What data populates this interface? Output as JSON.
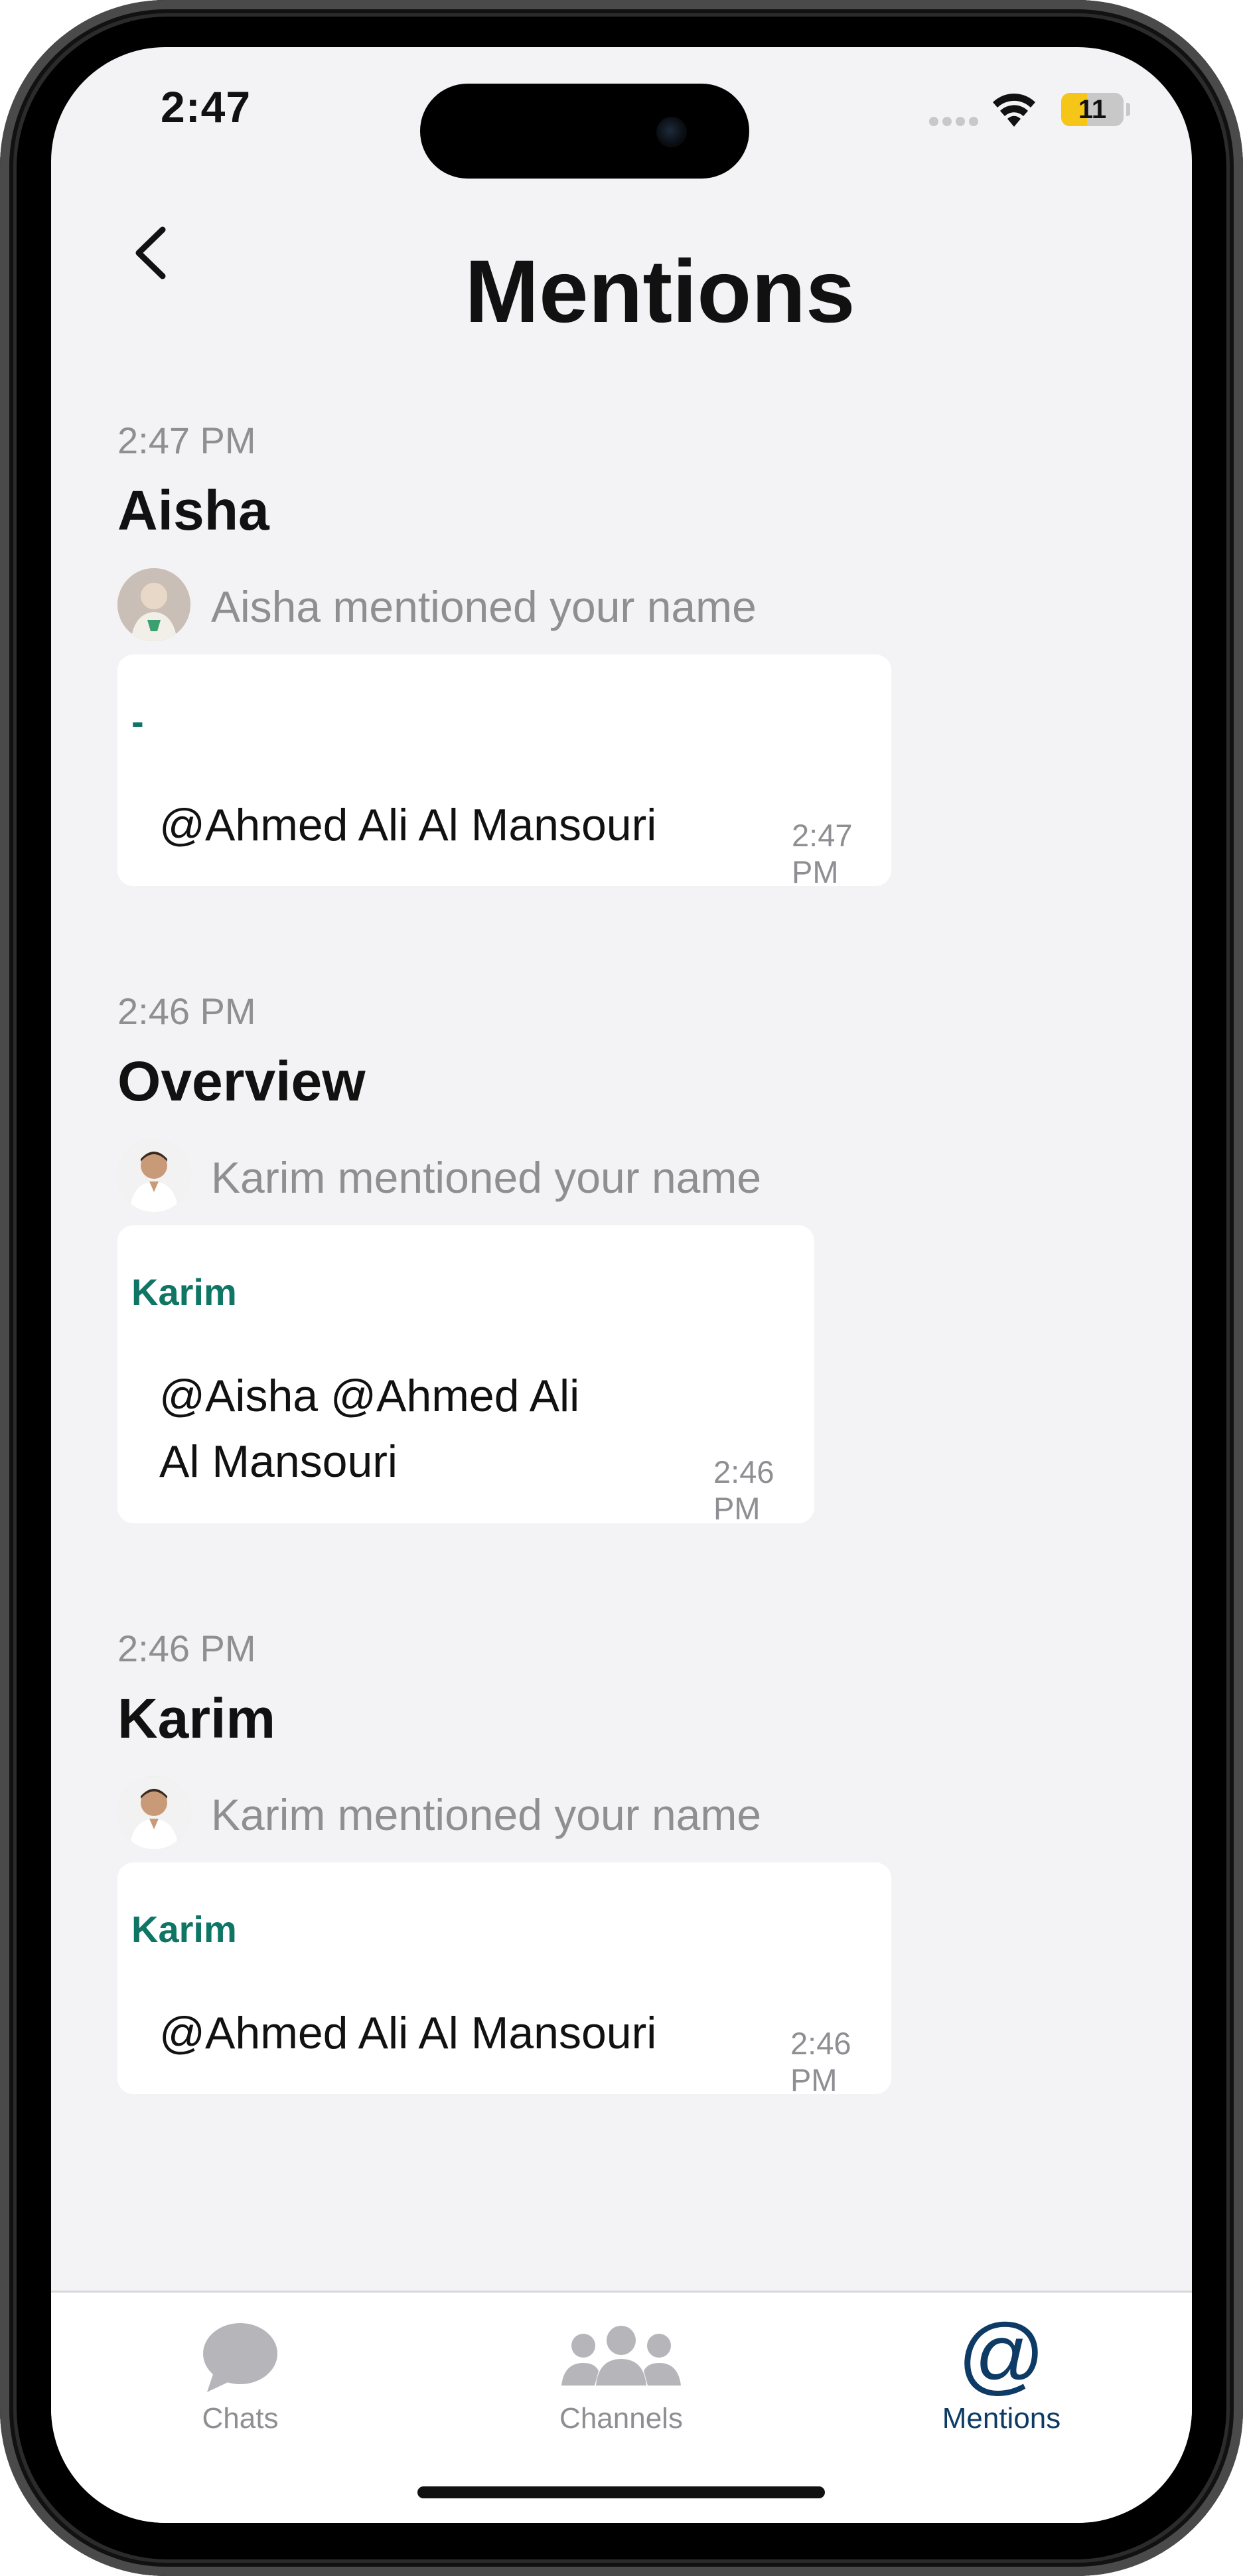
{
  "status_bar": {
    "time": "2:47",
    "battery": "11",
    "battery_fraction": 0.42
  },
  "header": {
    "title": "Mentions",
    "back_icon": "chevron-left-icon"
  },
  "mentions": [
    {
      "time": "2:47 PM",
      "title": "Aisha",
      "mention_text": "Aisha mentioned your name",
      "sender": "-",
      "body_lines": [
        "@Ahmed Ali Al Mansouri"
      ],
      "message_time": "2:47 PM"
    },
    {
      "time": "2:46 PM",
      "title": "Overview",
      "mention_text": "Karim mentioned your name",
      "sender": "Karim",
      "body_lines": [
        "@Aisha @Ahmed Ali",
        "Al Mansouri"
      ],
      "message_time": "2:46 PM"
    },
    {
      "time": "2:46 PM",
      "title": "Karim",
      "mention_text": "Karim mentioned your name",
      "sender": "Karim",
      "body_lines": [
        "@Ahmed Ali Al Mansouri"
      ],
      "message_time": "2:46 PM"
    }
  ],
  "tabbar": {
    "tabs": [
      {
        "label": "Chats",
        "icon": "chat-bubble-icon",
        "active": false
      },
      {
        "label": "Channels",
        "icon": "people-group-icon",
        "active": false
      },
      {
        "label": "Mentions",
        "icon": "at-sign-icon",
        "active": true
      }
    ]
  },
  "colors": {
    "accent": "#0d3b66",
    "sender": "#0f7565",
    "muted": "#8e8e93",
    "background": "#f3f3f5"
  }
}
